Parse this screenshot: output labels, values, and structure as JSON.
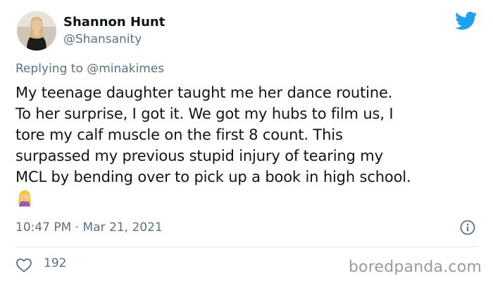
{
  "author": {
    "display_name": "Shannon Hunt",
    "handle": "@Shansanity"
  },
  "reply": {
    "prefix": "Replying to",
    "mention": "@minakimes"
  },
  "tweet": {
    "lines": [
      "My teenage daughter taught me her dance routine.",
      "To her surprise, I got it. We got my hubs to film us, I",
      "tore my calf muscle on the first 8 count. This",
      "surpassed my previous stupid injury of tearing my",
      "MCL by bending over to pick up a book in high school."
    ],
    "emoji": "woman-facepalming-emoji",
    "timestamp": "10:47 PM · Mar 21, 2021"
  },
  "engagement": {
    "like_count": "192"
  },
  "watermark": "boredpanda.com",
  "icons": {
    "brand": "twitter-bird-icon",
    "info": "info-icon",
    "like": "heart-icon"
  },
  "colors": {
    "twitter_blue": "#1da1f2",
    "secondary_text": "#5b7083",
    "primary_text": "#0f1419",
    "watermark": "#9a9a9a"
  }
}
